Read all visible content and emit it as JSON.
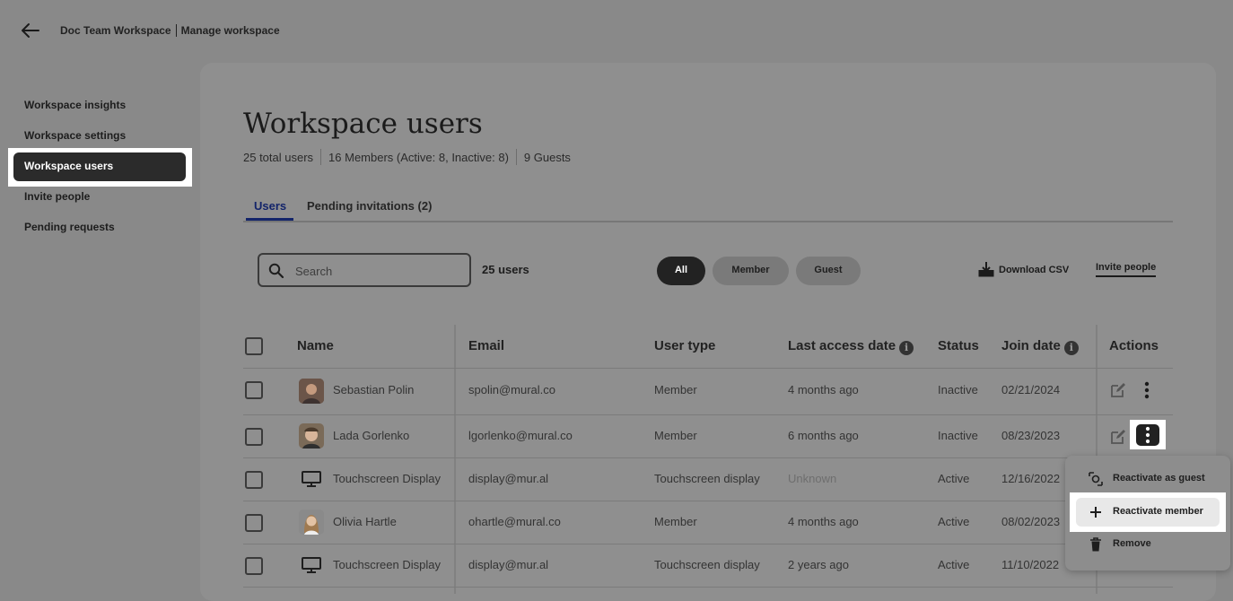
{
  "header": {
    "workspace_name": "Doc Team Workspace",
    "page_name": "Manage workspace"
  },
  "sidebar": {
    "items": [
      {
        "label": "Workspace insights"
      },
      {
        "label": "Workspace settings"
      },
      {
        "label": "Workspace users",
        "active": true
      },
      {
        "label": "Invite people"
      },
      {
        "label": "Pending requests"
      }
    ]
  },
  "main": {
    "title": "Workspace users",
    "summary": {
      "total": "25 total users",
      "members": "16 Members (Active: 8, Inactive: 8)",
      "guests": "9 Guests"
    },
    "tabs": [
      {
        "label": "Users",
        "active": true
      },
      {
        "label": "Pending invitations (2)"
      }
    ],
    "search": {
      "placeholder": "Search",
      "value": ""
    },
    "user_count": "25 users",
    "filters": [
      {
        "label": "All",
        "selected": true
      },
      {
        "label": "Member"
      },
      {
        "label": "Guest"
      }
    ],
    "download_label": "Download CSV",
    "invite_label": "Invite people"
  },
  "table": {
    "columns": [
      "Name",
      "Email",
      "User type",
      "Last access date",
      "Status",
      "Join date",
      "Actions"
    ],
    "rows": [
      {
        "name": "Sebastian Polin",
        "email": "spolin@mural.co",
        "user_type": "Member",
        "last_access": "4 months ago",
        "status": "Inactive",
        "join_date": "02/21/2024",
        "icon": "avatar"
      },
      {
        "name": "Lada Gorlenko",
        "email": "lgorlenko@mural.co",
        "user_type": "Member",
        "last_access": "6 months ago",
        "status": "Inactive",
        "join_date": "08/23/2023",
        "icon": "avatar"
      },
      {
        "name": "Touchscreen Display",
        "email": "display@mur.al",
        "user_type": "Touchscreen display",
        "last_access": "Unknown",
        "status": "Active",
        "join_date": "12/16/2022",
        "icon": "display-icon"
      },
      {
        "name": "Olivia Hartle",
        "email": "ohartle@mural.co",
        "user_type": "Member",
        "last_access": "4 months ago",
        "status": "Active",
        "join_date": "08/02/2023",
        "icon": "avatar"
      },
      {
        "name": "Touchscreen Display",
        "email": "display@mur.al",
        "user_type": "Touchscreen display",
        "last_access": "2 years ago",
        "status": "Active",
        "join_date": "11/10/2022",
        "icon": "display-icon"
      }
    ]
  },
  "actions_menu": {
    "items": [
      {
        "label": "Reactivate as guest",
        "icon": "reactivate-guest-icon"
      },
      {
        "label": "Reactivate member",
        "icon": "plus-icon",
        "highlighted": true
      },
      {
        "label": "Remove",
        "icon": "trash-icon"
      }
    ]
  }
}
